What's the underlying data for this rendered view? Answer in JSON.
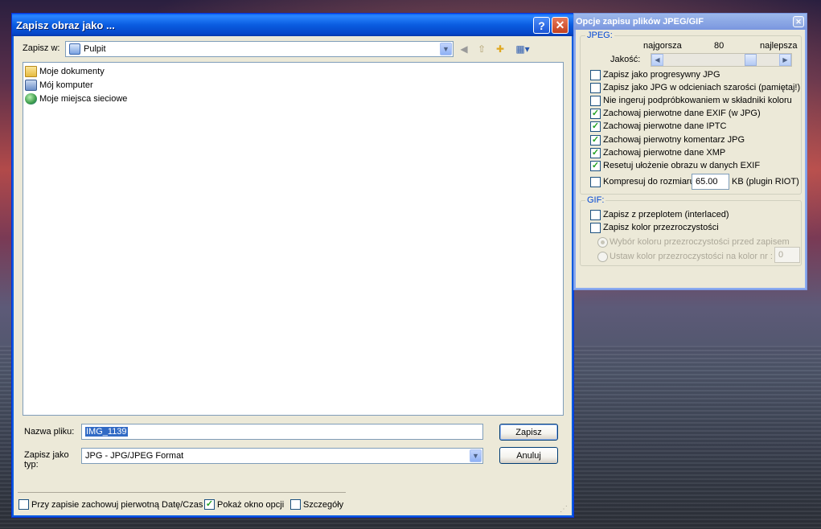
{
  "save_dialog": {
    "title": "Zapisz obraz jako ...",
    "save_in_label": "Zapisz w:",
    "save_in_value": "Pulpit",
    "items": [
      {
        "label": "Moje dokumenty",
        "icon": "my-documents-folder-icon"
      },
      {
        "label": "Mój komputer",
        "icon": "my-computer-icon"
      },
      {
        "label": "Moje miejsca sieciowe",
        "icon": "network-places-icon"
      }
    ],
    "filename_label": "Nazwa pliku:",
    "filename_value": "IMG_1139",
    "filetype_label": "Zapisz jako typ:",
    "filetype_value": "JPG - JPG/JPEG Format",
    "save_button": "Zapisz",
    "cancel_button": "Anuluj",
    "bottom_options": [
      {
        "label": "Przy zapisie zachowuj pierwotną Datę/Czas",
        "checked": false
      },
      {
        "label": "Pokaż okno opcji",
        "checked": true
      },
      {
        "label": "Szczegóły",
        "checked": false
      }
    ]
  },
  "options_dialog": {
    "title": "Opcje zapisu plików JPEG/GIF",
    "jpeg_group": "JPEG:",
    "quality_min_label": "najgorsza",
    "quality_value": "80",
    "quality_max_label": "najlepsza",
    "quality_label": "Jakość:",
    "jpeg_options": [
      {
        "label": "Zapisz jako progresywny JPG",
        "checked": false
      },
      {
        "label": "Zapisz jako JPG w odcieniach szarości  (pamiętaj!)",
        "checked": false
      },
      {
        "label": "Nie ingeruj podpróbkowaniem w składniki koloru",
        "checked": false
      },
      {
        "label": "Zachowaj pierwotne dane EXIF (w JPG)",
        "checked": true
      },
      {
        "label": "Zachowaj pierwotne dane IPTC",
        "checked": true
      },
      {
        "label": "Zachowaj pierwotny komentarz JPG",
        "checked": true
      },
      {
        "label": "Zachowaj pierwotne dane XMP",
        "checked": true
      },
      {
        "label": "Resetuj ułożenie obrazu w danych EXIF",
        "checked": true
      }
    ],
    "compress_label": "Kompresuj do rozmiaru:",
    "compress_value": "65.00",
    "compress_unit": "KB (plugin RIOT)",
    "gif_group": "GIF:",
    "gif_options": [
      {
        "label": "Zapisz z przeplotem (interlaced)",
        "checked": false
      },
      {
        "label": "Zapisz kolor przezroczystości",
        "checked": false
      }
    ],
    "radio_pick_color": "Wybór koloru przezroczystości przed zapisem",
    "radio_set_color": "Ustaw kolor przezroczystości na kolor nr :",
    "color_index_value": "0"
  }
}
